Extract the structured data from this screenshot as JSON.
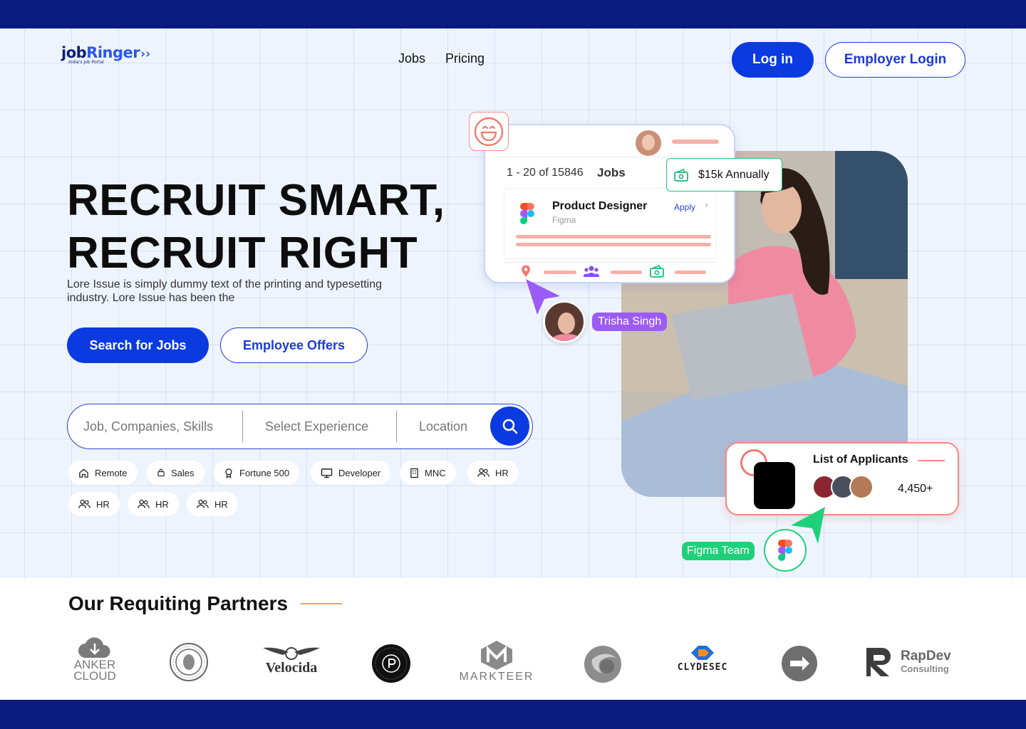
{
  "logo": {
    "brand_part1": "job",
    "brand_part2": "Ringer",
    "tagline": "India's Job Portal"
  },
  "nav": {
    "jobs": "Jobs",
    "pricing": "Pricing"
  },
  "header_buttons": {
    "login": "Log in",
    "employer_login": "Employer Login"
  },
  "hero": {
    "headline_line1": "RECRUIT SMART,",
    "headline_line2": "RECRUIT RIGHT",
    "description": "Lore Issue is simply dummy text of the printing and typesetting industry. Lore Issue has been the",
    "primary_cta": "Search for Jobs",
    "secondary_cta": "Employee Offers"
  },
  "search": {
    "job_placeholder": "Job, Companies, Skills",
    "experience_placeholder": "Select Experience",
    "location_placeholder": "Location"
  },
  "chips": [
    {
      "label": "Remote",
      "icon": "home-icon"
    },
    {
      "label": "Sales",
      "icon": "bag-icon"
    },
    {
      "label": "Fortune 500",
      "icon": "award-icon"
    },
    {
      "label": "Developer",
      "icon": "monitor-icon"
    },
    {
      "label": "MNC",
      "icon": "building-icon"
    },
    {
      "label": "HR",
      "icon": "users-icon"
    },
    {
      "label": "HR",
      "icon": "users-icon"
    },
    {
      "label": "HR",
      "icon": "users-icon"
    },
    {
      "label": "HR",
      "icon": "users-icon"
    }
  ],
  "job_card": {
    "count_text": "1 - 20 of 15846",
    "jobs_label": "Jobs",
    "job_title": "Product Designer",
    "company": "Figma",
    "apply": "Apply"
  },
  "salary_badge": {
    "text": "$15k Annually"
  },
  "user_tag": {
    "name": "Trisha Singh"
  },
  "applicants_card": {
    "title": "List of Applicants",
    "count": "4,450+"
  },
  "team_tag": {
    "name": "Figma Team"
  },
  "partners": {
    "title": "Our Requiting Partners",
    "logos": [
      {
        "name": "anker-cloud-logo",
        "text1": "ANKER",
        "text2": "CLOUD"
      },
      {
        "name": "seal-logo"
      },
      {
        "name": "velocida-logo",
        "text1": "Velocida"
      },
      {
        "name": "circle-p-logo"
      },
      {
        "name": "markteer-logo",
        "text1": "MARKTEER"
      },
      {
        "name": "sphere-logo"
      },
      {
        "name": "clydesec-logo",
        "text1": "CLYDESEC"
      },
      {
        "name": "arrow-logo"
      },
      {
        "name": "rapdev-logo",
        "text1": "RapDev",
        "text2": "Consulting"
      }
    ]
  },
  "colors": {
    "navy": "#0a1a7f",
    "primary": "#0a3ae0",
    "purple": "#9b5cf6",
    "green": "#1fd07a",
    "coral": "#f58a80"
  }
}
